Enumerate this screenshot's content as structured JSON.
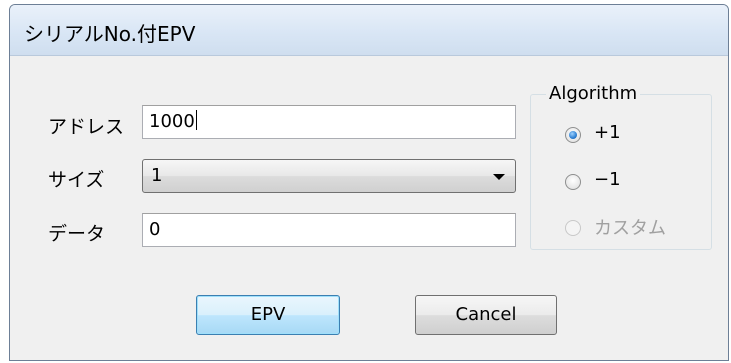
{
  "window": {
    "title": "シリアルNo.付EPV"
  },
  "form": {
    "address_label": "アドレス",
    "address_value": "1000",
    "size_label": "サイズ",
    "size_value": "1",
    "data_label": "データ",
    "data_value": "0"
  },
  "algorithm": {
    "legend": "Algorithm",
    "options": [
      {
        "label": "+1",
        "checked": true,
        "enabled": true
      },
      {
        "label": "−1",
        "checked": false,
        "enabled": true
      },
      {
        "label": "カスタム",
        "checked": false,
        "enabled": false
      }
    ]
  },
  "buttons": {
    "ok_label": "EPV",
    "cancel_label": "Cancel"
  },
  "colors": {
    "title_bar": "#d9e6f5",
    "dialog_bg": "#f0f0f0",
    "default_button": "#bee6fd",
    "radio_selected": "#2d7fd2"
  }
}
